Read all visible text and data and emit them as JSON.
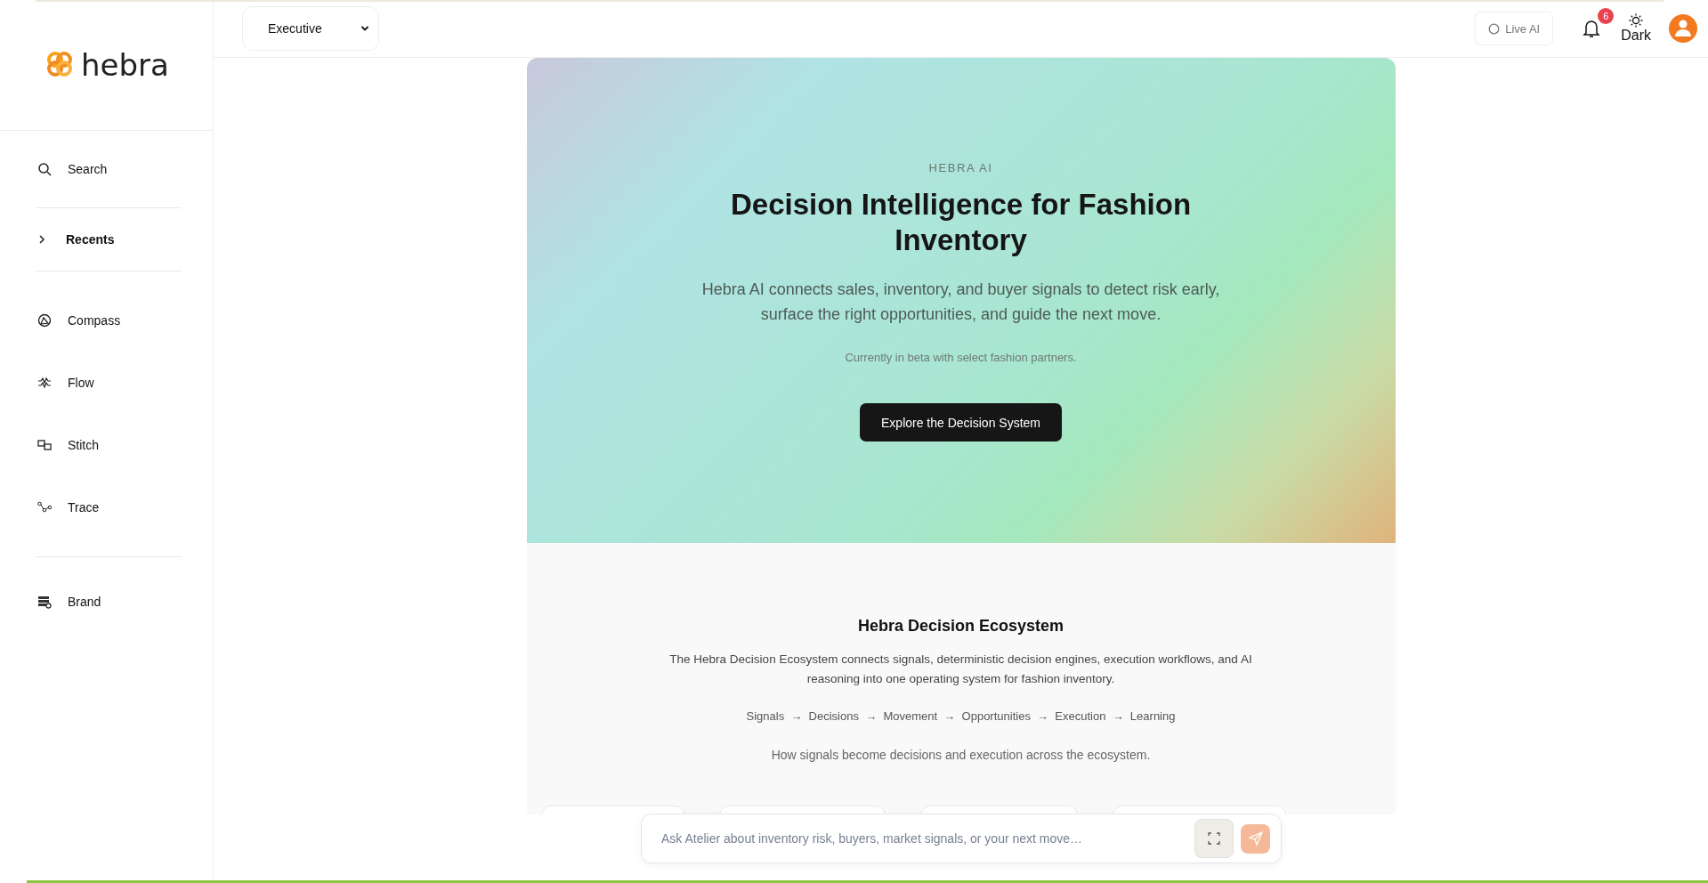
{
  "sidebar": {
    "logo_text": "hebra",
    "items": [
      {
        "kind": "search",
        "label": "Search"
      },
      {
        "kind": "divider"
      },
      {
        "kind": "group",
        "label": "Recents",
        "expanded": false
      },
      {
        "kind": "divider"
      },
      {
        "kind": "compass",
        "label": "Compass"
      },
      {
        "kind": "flow",
        "label": "Flow"
      },
      {
        "kind": "stitch",
        "label": "Stitch"
      },
      {
        "kind": "trace",
        "label": "Trace"
      },
      {
        "kind": "divider"
      },
      {
        "kind": "brand",
        "label": "Brand"
      }
    ]
  },
  "topbar": {
    "role_select": {
      "value": "Executive"
    },
    "live_ai": {
      "label": "Live AI"
    },
    "notifications": {
      "count": "6"
    },
    "theme_toggle": {
      "label": "Dark"
    }
  },
  "hero": {
    "eyebrow": "HEBRA AI",
    "title": "Decision Intelligence for Fashion Inventory",
    "description": "Hebra AI connects sales, inventory, and buyer signals to detect risk early, surface the right opportunities, and guide the next move.",
    "note": "Currently in beta with select fashion partners.",
    "button": "Explore the Decision System"
  },
  "ecosystem": {
    "title": "Hebra Decision Ecosystem",
    "description": "The Hebra Decision Ecosystem connects signals, deterministic decision engines, execution workflows, and AI reasoning into one operating system for fashion inventory.",
    "flow": "Signals  →  Decisions  →  Movement  →  Opportunities  →  Execution  →  Learning",
    "caption": "How signals become decisions and execution across the ecosystem."
  },
  "chat": {
    "placeholder": "Ask Atelier about inventory risk, buyers, market signals, or your next move…"
  }
}
